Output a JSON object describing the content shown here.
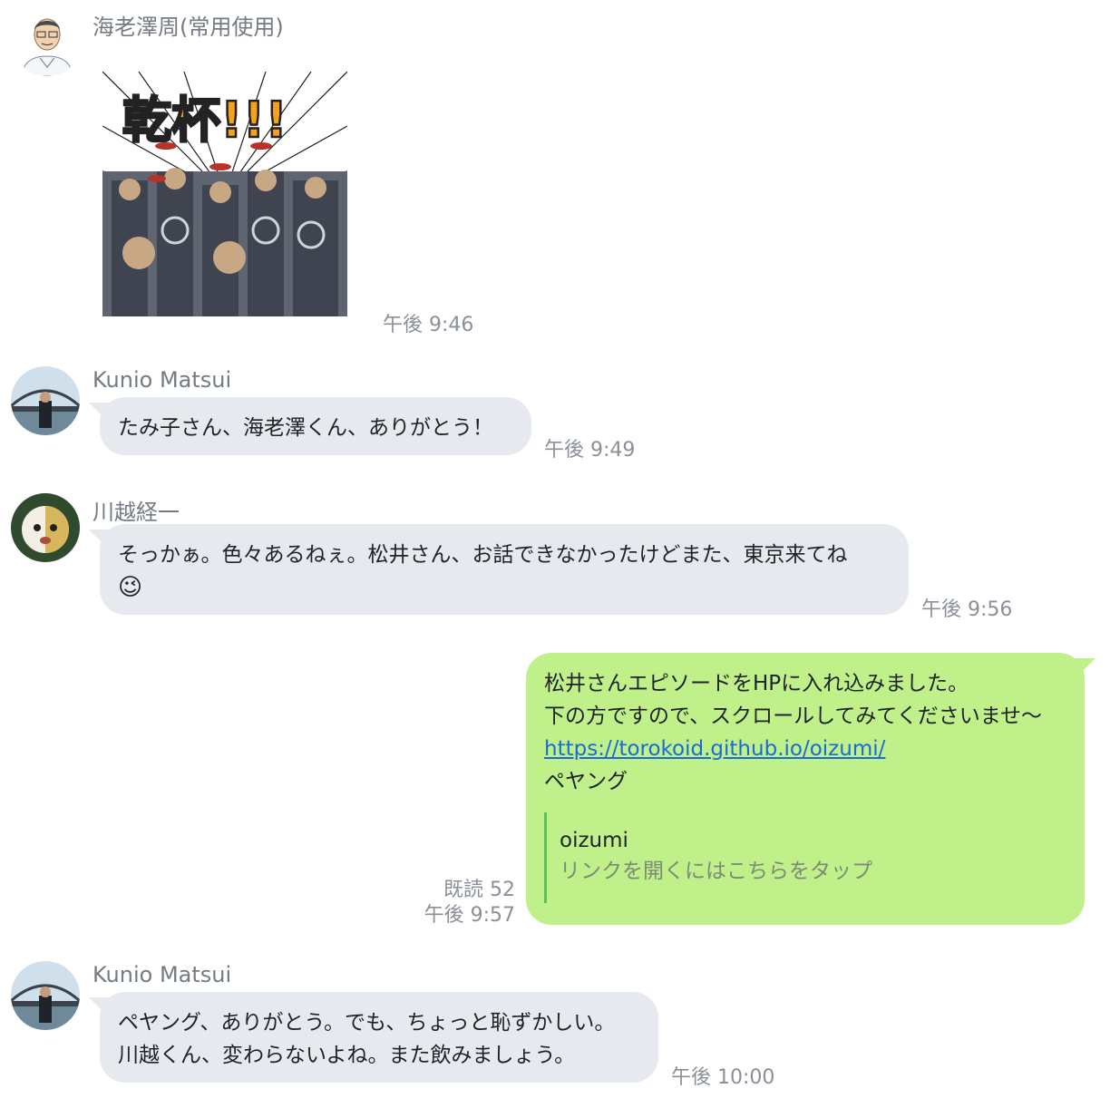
{
  "messages": [
    {
      "sender": "海老澤周(常用使用)",
      "sticker_text": "乾杯!!!",
      "time": "午後 9:46"
    },
    {
      "sender": "Kunio Matsui",
      "text": "たみ子さん、海老澤くん、ありがとう！",
      "time": "午後 9:49"
    },
    {
      "sender": "川越経一",
      "text_line1": "そっかぁ。色々あるねぇ。松井さん、お話できなかったけどまた、東京来てね",
      "emoji": "😉",
      "time": "午後 9:56"
    },
    {
      "line1": "松井さんエピソードをHPに入れ込みました。",
      "line2": "下の方ですので、スクロールしてみてくださいませ〜",
      "link": "https://torokoid.github.io/oizumi/",
      "line4": "ペヤング",
      "preview_title": "oizumi",
      "preview_sub": "リンクを開くにはこちらをタップ",
      "read": "既読 52",
      "time": "午後 9:57"
    },
    {
      "sender": "Kunio Matsui",
      "line1": "ペヤング、ありがとう。でも、ちょっと恥ずかしい。",
      "line2": "川越くん、変わらないよね。また飲みましょう。",
      "time": "午後 10:00"
    }
  ],
  "colors": {
    "incoming_bubble": "#e6e9ee",
    "outgoing_bubble": "#c0f08a",
    "link": "#1a6bd6"
  }
}
